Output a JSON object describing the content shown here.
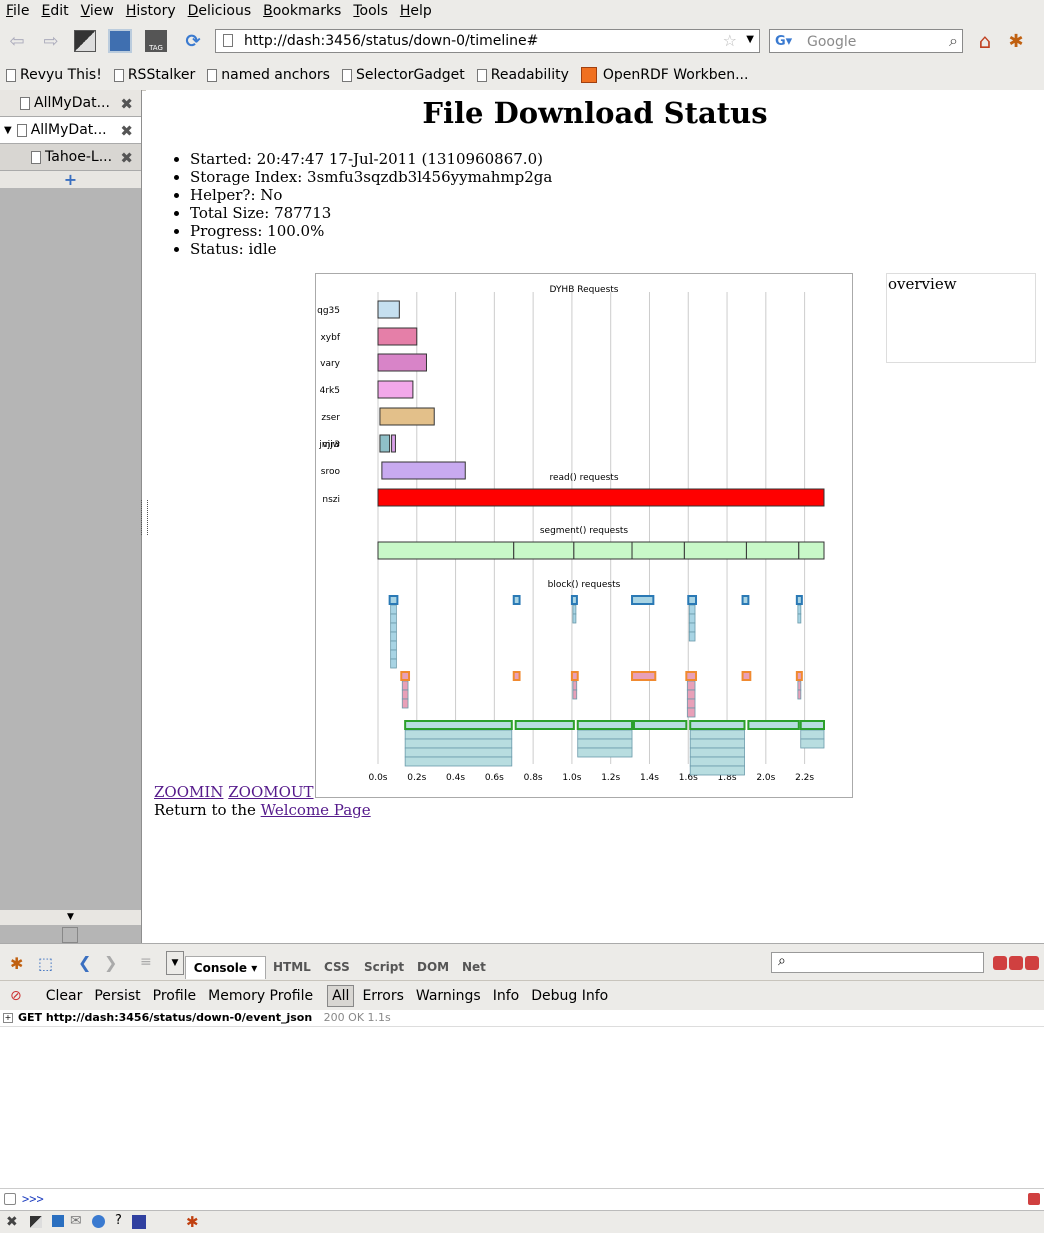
{
  "menu": [
    "File",
    "Edit",
    "View",
    "History",
    "Delicious",
    "Bookmarks",
    "Tools",
    "Help"
  ],
  "url": "http://dash:3456/status/down-0/timeline#",
  "search_placeholder": "Google",
  "bookmarks": [
    "Revyu This!",
    "RSStalker",
    "named anchors",
    "SelectorGadget",
    "Readability",
    "OpenRDF Workben..."
  ],
  "sidebar_tabs": [
    "AllMyDat...",
    "AllMyDat...",
    "Tahoe-L..."
  ],
  "page": {
    "title": "File Download Status",
    "info": [
      "Started: 20:47:47 17-Jul-2011 (1310960867.0)",
      "Storage Index: 3smfu3sqzdb3l456yymahmp2ga",
      "Helper?: No",
      "Total Size: 787713",
      "Progress: 100.0%",
      "Status: idle"
    ],
    "overview_label": "overview",
    "zoomin": "ZOOMIN",
    "zoomout": "ZOOMOUT",
    "return_prefix": "Return to the",
    "return_link": "Welcome Page"
  },
  "chart_data": {
    "type": "timeline",
    "xlim": [
      0,
      2.3
    ],
    "ticks": [
      "0.0s",
      "0.2s",
      "0.4s",
      "0.6s",
      "0.8s",
      "1.0s",
      "1.2s",
      "1.4s",
      "1.6s",
      "1.8s",
      "2.0s",
      "2.2s"
    ],
    "sections": {
      "dyhb": "DYHB Requests",
      "read": "read() requests",
      "segment": "segment() requests",
      "block": "block() requests"
    },
    "dyhb": [
      {
        "server": "qg35",
        "start": 0.0,
        "end": 0.11,
        "color": "#c6e0f0"
      },
      {
        "server": "xybf",
        "start": 0.0,
        "end": 0.2,
        "color": "#e57fa8"
      },
      {
        "server": "vary",
        "start": 0.0,
        "end": 0.25,
        "color": "#d884c8"
      },
      {
        "server": "4rk5",
        "start": 0.0,
        "end": 0.18,
        "color": "#f2a8ea"
      },
      {
        "server": "zser",
        "start": 0.01,
        "end": 0.29,
        "color": "#e3c08a"
      },
      {
        "server": "vjjw",
        "start": 0.01,
        "end": 0.06,
        "color": "#8fc0c8"
      },
      {
        "server": "jmr3",
        "start": 0.07,
        "end": 0.09,
        "color": "#d8a0e8"
      },
      {
        "server": "sroo",
        "start": 0.02,
        "end": 0.45,
        "color": "#c8aaf0"
      }
    ],
    "read": [
      {
        "label": "nszi",
        "start": 0.0,
        "end": 2.3,
        "color": "#ff0000"
      }
    ],
    "segments": [
      [
        0.0,
        0.7
      ],
      [
        0.7,
        1.01
      ],
      [
        1.01,
        1.31
      ],
      [
        1.31,
        1.58
      ],
      [
        1.58,
        1.9
      ],
      [
        1.9,
        2.17
      ],
      [
        2.17,
        2.3
      ]
    ],
    "block_rows": [
      {
        "name": "blue",
        "color": "#2a79b5",
        "fill": "#a8d4e4",
        "blocks": [
          [
            0.06,
            0.1
          ],
          [
            0.7,
            0.73
          ],
          [
            1.0,
            1.02
          ],
          [
            1.31,
            1.42
          ],
          [
            1.6,
            1.64
          ],
          [
            1.88,
            1.91
          ],
          [
            2.16,
            2.18
          ]
        ]
      },
      {
        "name": "orange",
        "color": "#f08a30",
        "fill": "#e8a0b8",
        "blocks": [
          [
            0.12,
            0.16
          ],
          [
            0.7,
            0.73
          ],
          [
            1.0,
            1.03
          ],
          [
            1.31,
            1.43
          ],
          [
            1.59,
            1.64
          ],
          [
            1.88,
            1.92
          ],
          [
            2.16,
            2.18
          ]
        ]
      },
      {
        "name": "green",
        "color": "#2ca02c",
        "fill": "#b8dde0",
        "blocks": [
          [
            0.14,
            0.69
          ],
          [
            0.71,
            1.01
          ],
          [
            1.03,
            1.31
          ],
          [
            1.32,
            1.59
          ],
          [
            1.61,
            1.89
          ],
          [
            1.91,
            2.17
          ],
          [
            2.18,
            2.3
          ]
        ]
      }
    ]
  },
  "firebug": {
    "tabs": [
      "Console",
      "HTML",
      "CSS",
      "Script",
      "DOM",
      "Net"
    ],
    "sub_buttons": [
      "Clear",
      "Persist",
      "Profile",
      "Memory Profile",
      "All",
      "Errors",
      "Warnings",
      "Info",
      "Debug Info"
    ],
    "log_request": "GET http://dash:3456/status/down-0/event_json",
    "log_status": "200 OK 1.1s",
    "prompt": ">>>"
  }
}
